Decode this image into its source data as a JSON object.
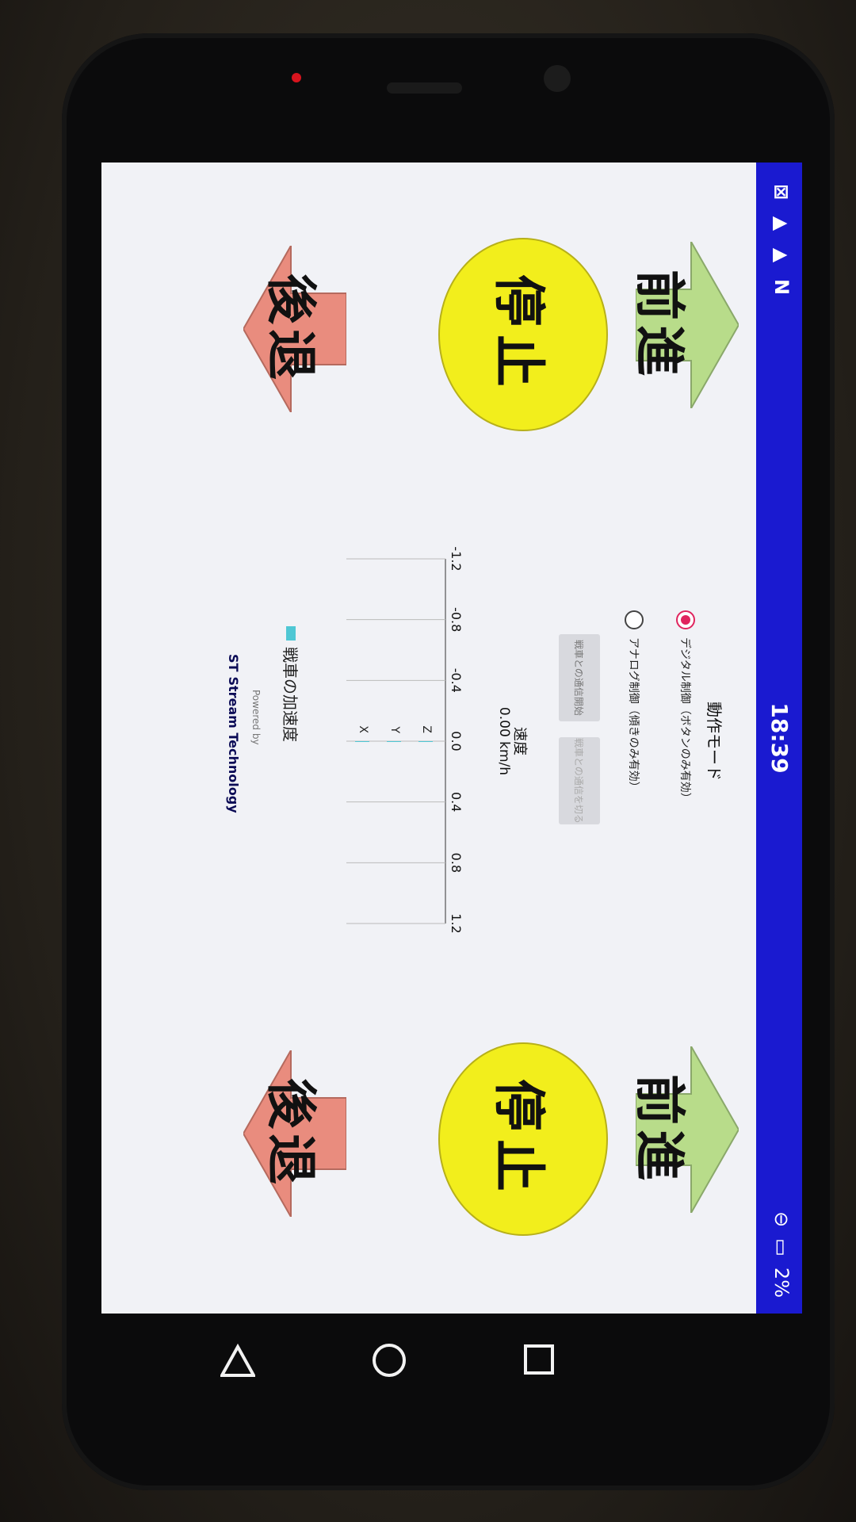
{
  "status_bar": {
    "time": "18:39",
    "battery": "2%",
    "left_icons": [
      "app-icon",
      "warning-icon",
      "warning-icon",
      "n-icon"
    ],
    "right_icons": [
      "do-not-disturb-icon",
      "battery-charging-icon"
    ]
  },
  "controls": {
    "left": {
      "forward_label": "前進",
      "stop_label": "停止",
      "back_label": "後退"
    },
    "right": {
      "forward_label": "前進",
      "stop_label": "停止",
      "back_label": "後退"
    }
  },
  "mode": {
    "title": "動作モード",
    "options": [
      {
        "label": "デジタル制御（ボタンのみ有効）",
        "selected": true
      },
      {
        "label": "アナログ制御（傾きのみ有効）",
        "selected": false
      }
    ]
  },
  "buttons": {
    "connect_start": "戦車との通信開始",
    "connect_stop": "戦車との通信を切る"
  },
  "speed": {
    "label": "速度",
    "value": "0.00 km/h"
  },
  "chart_data": {
    "type": "bar",
    "orientation": "horizontal",
    "categories": [
      "Z",
      "Y",
      "X"
    ],
    "series": [
      {
        "name": "戦車の加速度",
        "values": [
          0,
          0,
          0
        ]
      }
    ],
    "xlim": [
      -1.2,
      1.2
    ],
    "ticks": [
      "-1.2",
      "-0.8",
      "-0.4",
      "0.0",
      "0.4",
      "0.8",
      "1.2"
    ],
    "grid": true,
    "legend": "bottom"
  },
  "footer": {
    "powered": "Powered by",
    "brand": "Stream Technology",
    "logo": "ST"
  },
  "colors": {
    "status_bar": "#1a1ad0",
    "forward": "#b8dc8a",
    "back": "#e98c7e",
    "stop": "#f2ee1c",
    "radio_on": "#e0245e"
  }
}
